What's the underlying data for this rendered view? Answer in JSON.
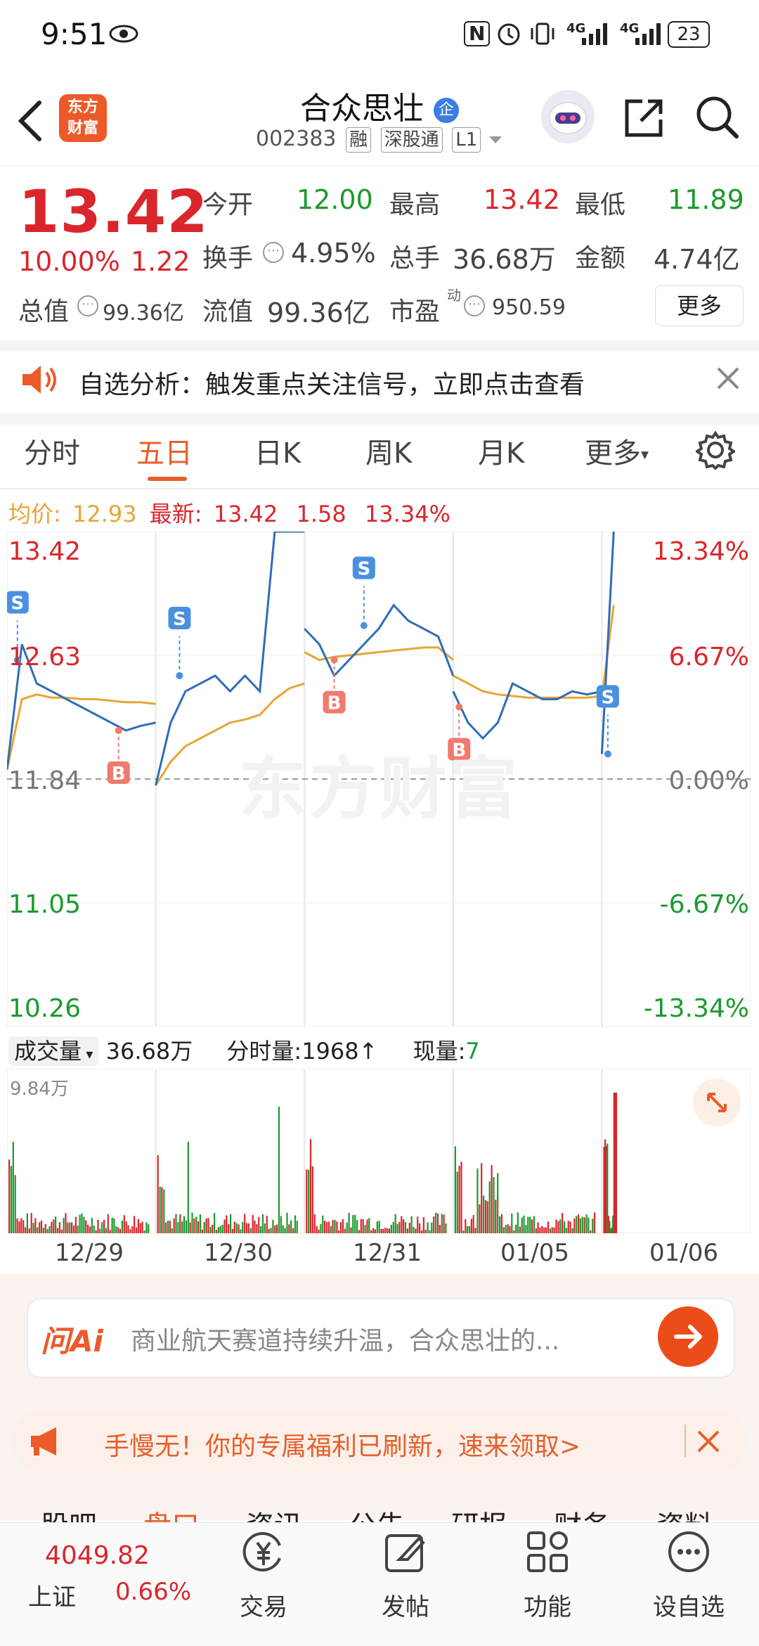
{
  "status_bar": {
    "time": "9:51",
    "nfc": "N",
    "net1": "4G",
    "net2": "4G",
    "battery": "23"
  },
  "header": {
    "logo_line1": "东方",
    "logo_line2": "财富",
    "stock_name": "合众思壮",
    "enterprise_badge": "企",
    "stock_code": "002383",
    "tags": [
      "融",
      "深股通",
      "L1"
    ]
  },
  "quote": {
    "price": "13.42",
    "change_pct": "10.00%",
    "change_amt": "1.22",
    "open_label": "今开",
    "open_value": "12.00",
    "high_label": "最高",
    "high_value": "13.42",
    "low_label": "最低",
    "low_value": "11.89",
    "turnover_label": "换手",
    "turnover_value": "4.95%",
    "volume_label": "总手",
    "volume_value": "36.68万",
    "amount_label": "金额",
    "amount_value": "4.74亿",
    "total_cap_label": "总值",
    "total_cap_value": "99.36亿",
    "float_cap_label": "流值",
    "float_cap_value": "99.36亿",
    "pe_label": "市盈",
    "pe_sup": "动",
    "pe_value": "950.59",
    "more_button": "更多"
  },
  "notice": {
    "text": "自选分析：触发重点关注信号，立即点击查看"
  },
  "tabs": [
    "分时",
    "五日",
    "日K",
    "周K",
    "月K",
    "更多"
  ],
  "active_tab": "五日",
  "summary": {
    "avg_label": "均价:",
    "avg_value": "12.93",
    "latest_label": "最新:",
    "latest_value": "13.42",
    "latest_change": "1.58",
    "latest_pct": "13.34%"
  },
  "chart_data": {
    "type": "line",
    "x": [
      "12/29",
      "12/30",
      "12/31",
      "01/05",
      "01/06"
    ],
    "y_left_ticks": [
      "13.42",
      "12.63",
      "11.84",
      "11.05",
      "10.26"
    ],
    "y_right_ticks": [
      "13.34%",
      "6.67%",
      "0.00%",
      "-6.67%",
      "-13.34%"
    ],
    "ylim": [
      10.26,
      13.42
    ],
    "baseline": 11.84,
    "watermark": "东方财富",
    "price_series": [
      [
        11.9,
        12.7,
        12.45,
        12.4,
        12.35,
        12.3,
        12.25,
        12.2,
        12.15,
        12.18,
        12.2
      ],
      [
        11.8,
        12.2,
        12.4,
        12.45,
        12.5,
        12.4,
        12.5,
        12.4,
        13.42,
        13.42,
        13.42
      ],
      [
        12.8,
        12.7,
        12.5,
        12.6,
        12.7,
        12.8,
        12.95,
        12.85,
        12.8,
        12.75,
        12.5
      ],
      [
        12.4,
        12.2,
        12.1,
        12.2,
        12.45,
        12.4,
        12.35,
        12.35,
        12.4,
        12.38,
        12.4
      ],
      [
        12.0,
        13.42
      ]
    ],
    "avg_series": [
      [
        11.9,
        12.35,
        12.38,
        12.36,
        12.36,
        12.35,
        12.35,
        12.34,
        12.33,
        12.33,
        12.32
      ],
      [
        11.8,
        11.95,
        12.05,
        12.1,
        12.15,
        12.2,
        12.22,
        12.25,
        12.35,
        12.42,
        12.45
      ],
      [
        12.65,
        12.6,
        12.62,
        12.63,
        12.64,
        12.65,
        12.66,
        12.67,
        12.68,
        12.68,
        12.6
      ],
      [
        12.5,
        12.45,
        12.4,
        12.38,
        12.37,
        12.36,
        12.36,
        12.36,
        12.36,
        12.36,
        12.37
      ],
      [
        12.36,
        12.95
      ]
    ],
    "markers": [
      {
        "label": "S",
        "day": 0,
        "pos": 0.07,
        "price": 12.6
      },
      {
        "label": "B",
        "day": 0,
        "pos": 0.75,
        "price": 12.15
      },
      {
        "label": "S",
        "day": 1,
        "pos": 0.16,
        "price": 12.5
      },
      {
        "label": "B",
        "day": 2,
        "pos": 0.2,
        "price": 12.6
      },
      {
        "label": "S",
        "day": 2,
        "pos": 0.4,
        "price": 12.82
      },
      {
        "label": "B",
        "day": 3,
        "pos": 0.04,
        "price": 12.3
      },
      {
        "label": "S",
        "day": 4,
        "pos": 0.5,
        "price": 12.0
      }
    ]
  },
  "volume": {
    "dropdown_label": "成交量",
    "total": "36.68万",
    "tick_volume_label": "分时量:",
    "tick_volume_value": "1968",
    "current_label": "现量:",
    "current_value": "7",
    "max_label": "9.84万"
  },
  "ai_bar": {
    "logo": "问Ai",
    "text": "商业航天赛道持续升温，合众思壮的..."
  },
  "promo": {
    "text": "手慢无！你的专属福利已刷新，速来领取>"
  },
  "sub_tabs": [
    "股吧",
    "盘口",
    "资讯",
    "公告",
    "研报",
    "财务",
    "资料"
  ],
  "bottom_nav": {
    "index_value": "4049.82",
    "index_name": "上证",
    "index_pct": "0.66%",
    "items": [
      "交易",
      "发帖",
      "功能",
      "设自选"
    ]
  },
  "colors": {
    "up": "#d9262c",
    "down": "#1a9a2e",
    "accent": "#e5602a",
    "price_line": "#2f6db5",
    "avg_line": "#e8a532"
  }
}
